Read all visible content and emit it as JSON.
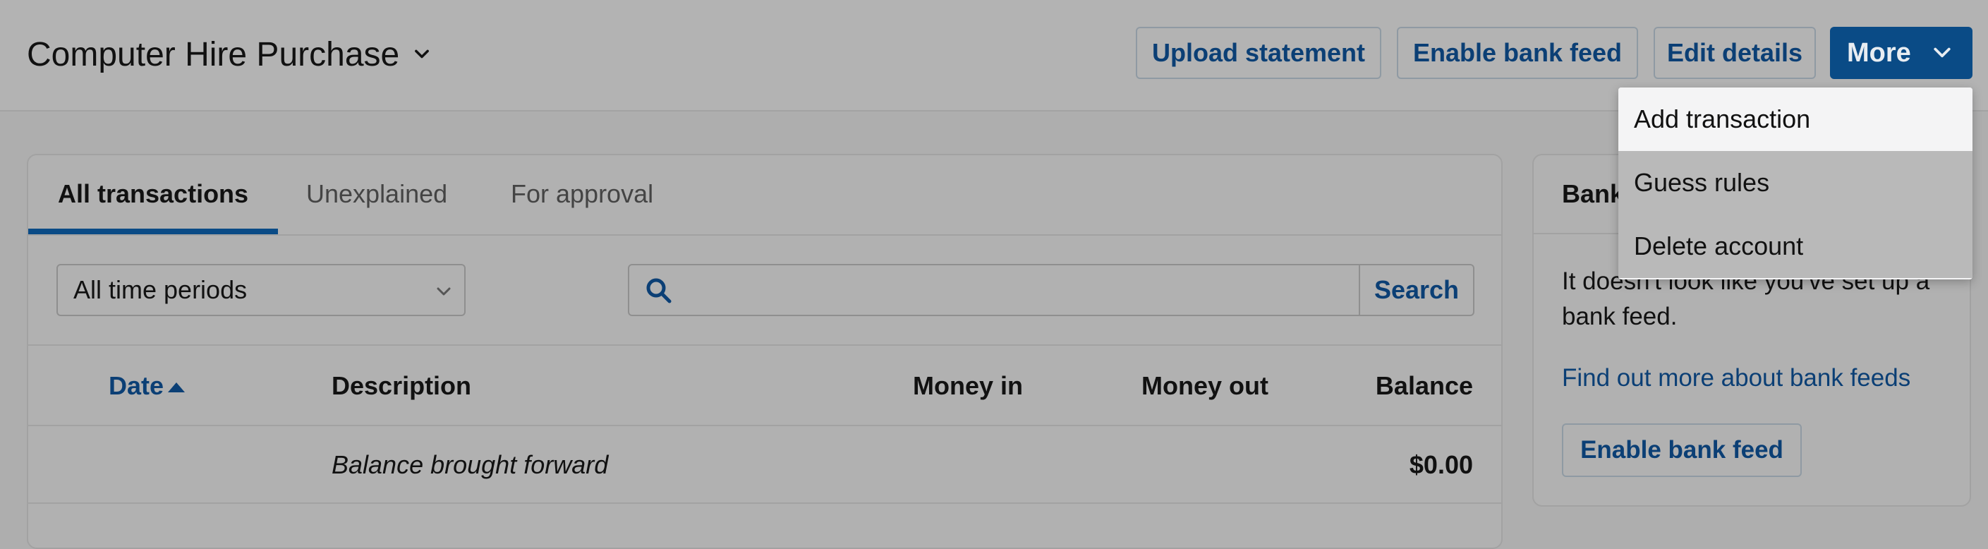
{
  "header": {
    "account_title": "Computer Hire Purchase",
    "buttons": {
      "upload_statement": "Upload statement",
      "enable_bank_feed": "Enable bank feed",
      "edit_details": "Edit details",
      "more": "More"
    }
  },
  "more_menu": {
    "items": [
      "Add transaction",
      "Guess rules",
      "Delete account"
    ],
    "highlighted": "Add transaction"
  },
  "tabs": [
    "All transactions",
    "Unexplained",
    "For approval"
  ],
  "active_tab": "All transactions",
  "filters": {
    "period": "All time periods",
    "search_placeholder": "",
    "search_button": "Search"
  },
  "table": {
    "columns": [
      "Date",
      "Description",
      "Money in",
      "Money out",
      "Balance"
    ],
    "sort": {
      "column": "Date",
      "direction": "ascending"
    },
    "rows": [
      {
        "date": "",
        "description": "Balance brought forward",
        "money_in": "",
        "money_out": "",
        "balance": "$0.00"
      }
    ]
  },
  "side_panel": {
    "heading": "Bank feed",
    "text": "It doesn't look like you've set up a bank feed.",
    "link": "Find out more about bank feeds",
    "button": "Enable bank feed"
  },
  "colors": {
    "accent": "#0a4b86",
    "link": "#0b3f75",
    "overlay_background": "#aeaeae",
    "menu_background": "#f4f4f5"
  },
  "icons": [
    "chevron-down-icon",
    "search-icon",
    "sort-ascending-icon"
  ]
}
